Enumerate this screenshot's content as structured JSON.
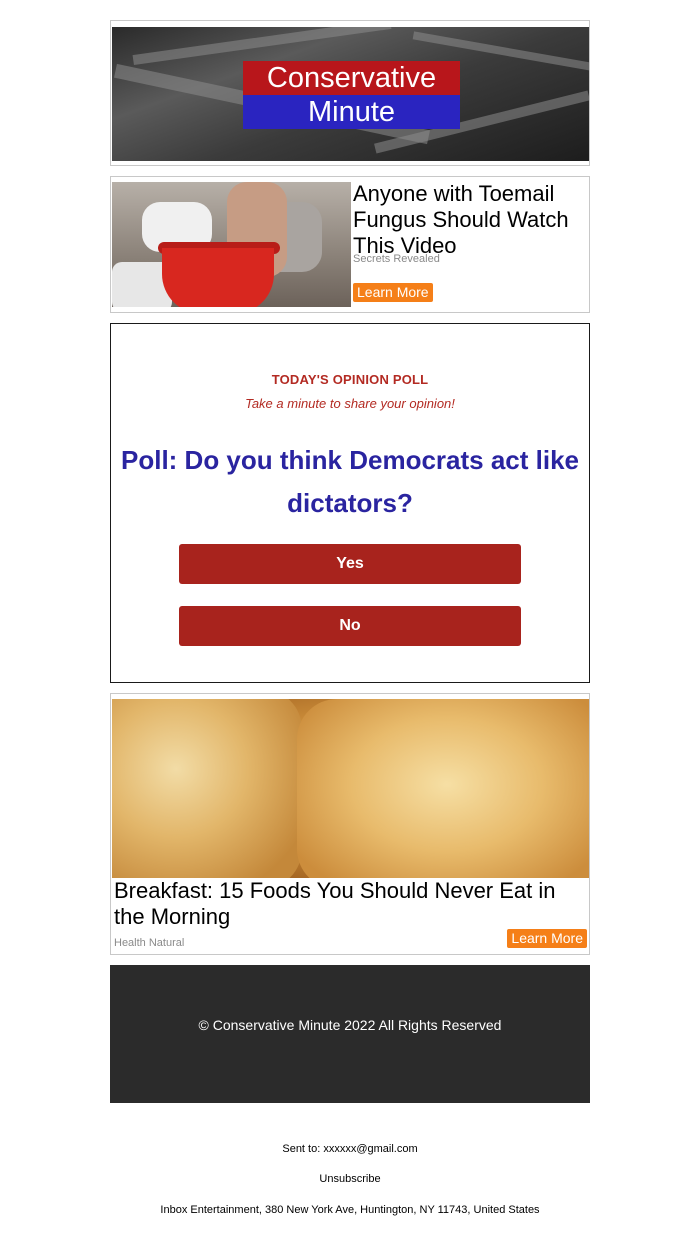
{
  "header": {
    "logo_line1": "Conservative",
    "logo_line2": "Minute"
  },
  "ad1": {
    "title": "Anyone with Toemail Fungus Should Watch This Video",
    "source": "Secrets Revealed",
    "cta": "Learn More"
  },
  "poll": {
    "kicker": "TODAY'S OPINION POLL",
    "subtitle": "Take a minute to share your opinion!",
    "question": "Poll: Do you think Democrats act like dictators?",
    "options": [
      "Yes",
      "No"
    ]
  },
  "ad2": {
    "title": "Breakfast: 15 Foods You Should Never Eat in the Morning",
    "source": "Health Natural",
    "cta": "Learn More"
  },
  "footer": {
    "copyright": "© Conservative Minute 2022 All Rights Reserved"
  },
  "meta": {
    "sent_to": "Sent to: xxxxxx@gmail.com",
    "unsubscribe": "Unsubscribe",
    "address": "Inbox Entertainment, 380 New York Ave, Huntington, NY 11743, United States"
  },
  "colors": {
    "accent_red": "#a8231d",
    "poll_blue": "#2a24a0",
    "cta_orange": "#f57f18",
    "footer_bg": "#2b2b2b"
  }
}
